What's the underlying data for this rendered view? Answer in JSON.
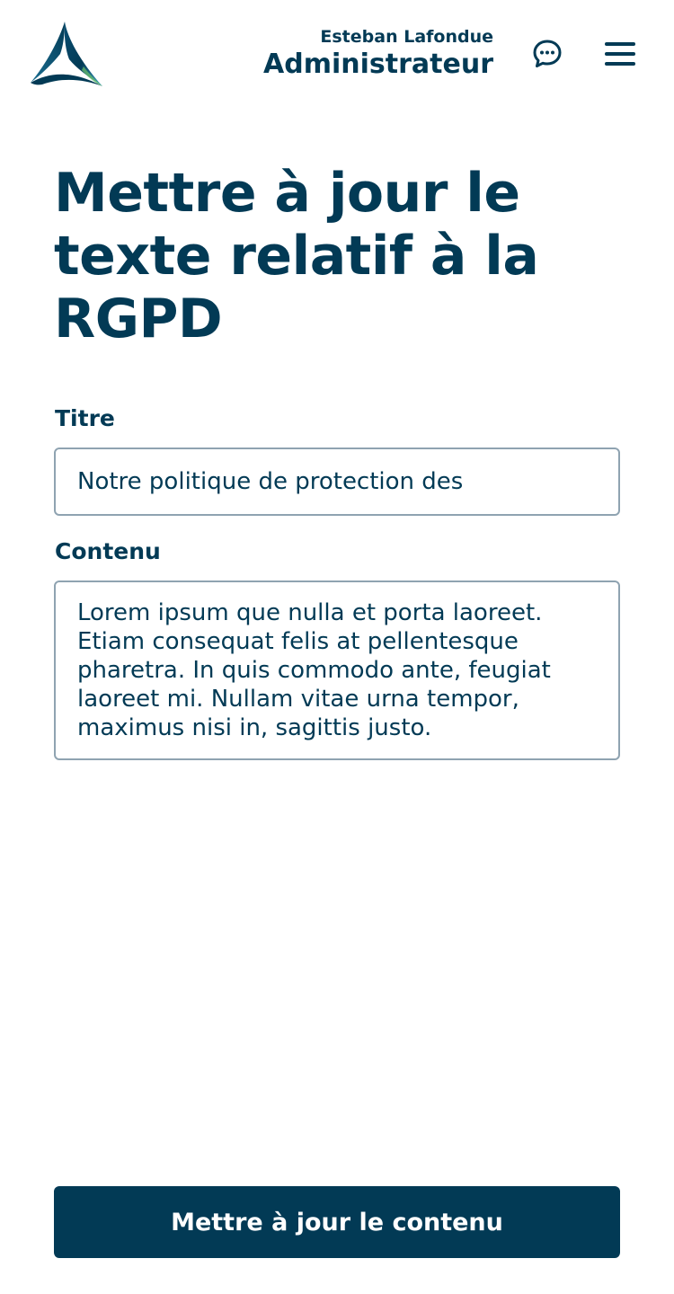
{
  "header": {
    "logo_icon": "triangle-logo-icon",
    "user_name": "Esteban Lafondue",
    "user_role": "Administrateur",
    "chat_icon": "chat-bubble-icon",
    "menu_icon": "hamburger-menu-icon"
  },
  "main": {
    "title": "Mettre à jour le texte relatif à la RGPD",
    "fields": {
      "titre": {
        "label": "Titre",
        "value": "Notre politique de protection des"
      },
      "contenu": {
        "label": "Contenu",
        "value": "Lorem ipsum que nulla et porta laoreet. Etiam consequat felis at pellentesque pharetra. In quis commodo ante, feugiat laoreet mi. Nullam vitae urna tempor, maximus nisi in, sagittis justo."
      }
    },
    "submit_label": "Mettre à jour le contenu"
  },
  "colors": {
    "primary": "#023a55",
    "border": "#8fa3b1",
    "background": "#ffffff"
  }
}
